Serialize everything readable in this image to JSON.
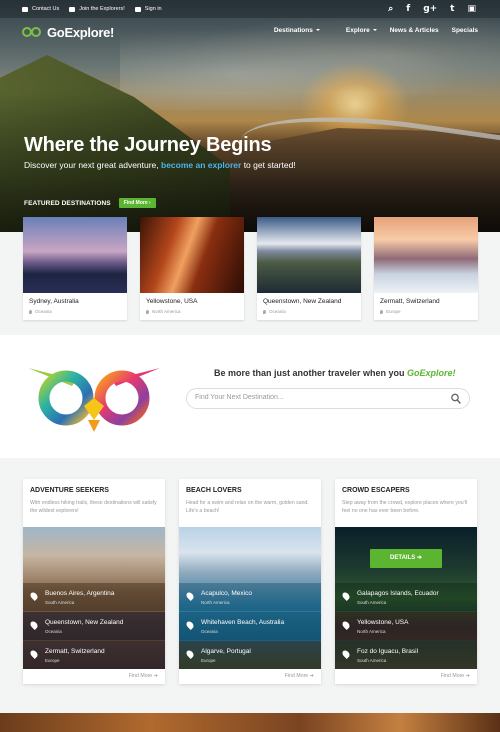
{
  "topbar": {
    "links": [
      "Contact Us",
      "Join the Explorers!",
      "Sign in"
    ],
    "social_icons": [
      "search-icon",
      "facebook-icon",
      "google-plus-icon",
      "twitter-icon",
      "instagram-icon"
    ]
  },
  "nav": {
    "brand": "GoExplore!",
    "items": [
      "Destinations",
      "Explore",
      "News & Articles",
      "Specials"
    ]
  },
  "hero": {
    "title": "Where the Journey Begins",
    "sub_before": "Discover your next great adventure, ",
    "sub_link": "become an explorer",
    "sub_after": " to get started!"
  },
  "featured": {
    "heading": "FEATURED DESTINATIONS",
    "button": "Find More",
    "cards": [
      {
        "title": "Sydney, Australia",
        "region": "Oceania"
      },
      {
        "title": "Yellowstone, USA",
        "region": "North America"
      },
      {
        "title": "Queenstown, New Zealand",
        "region": "Oceania"
      },
      {
        "title": "Zermatt, Switzerland",
        "region": "Europe"
      }
    ]
  },
  "promo": {
    "text_before": "Be more than just another traveler when you ",
    "brand": "GoExplore!",
    "search_placeholder": "Find Your Next Destination..."
  },
  "categories": [
    {
      "title": "ADVENTURE SEEKERS",
      "desc": "With endless hiking trails, these destinations will satisfy the wildest explorers!",
      "rows": [
        {
          "name": "Buenos Aires, Argentina",
          "region": "South America"
        },
        {
          "name": "Queenstown, New Zealand",
          "region": "Oceania"
        },
        {
          "name": "Zermatt, Switzerland",
          "region": "Europe"
        }
      ],
      "more": "Find More"
    },
    {
      "title": "BEACH LOVERS",
      "desc": "Head for a swim and relax on the warm, golden sand. Life's a beach!",
      "rows": [
        {
          "name": "Acapulco, Mexico",
          "region": "North America"
        },
        {
          "name": "Whitehaven Beach, Australia",
          "region": "Oceania"
        },
        {
          "name": "Algarve, Portugal",
          "region": "Europe"
        }
      ],
      "more": "Find More"
    },
    {
      "title": "CROWD ESCAPERS",
      "desc": "Step away from the crowd, explore places where you'll feel no one has ever been before.",
      "details_button": "DETAILS",
      "rows": [
        {
          "name": "Galapagos Islands, Ecuador",
          "region": "South America"
        },
        {
          "name": "Yellowstone, USA",
          "region": "North America"
        },
        {
          "name": "Foz do Iguacu, Brasil",
          "region": "South America"
        }
      ],
      "more": "Find More"
    }
  ],
  "colors": {
    "accent": "#5cb531",
    "link": "#4fb3e6"
  }
}
